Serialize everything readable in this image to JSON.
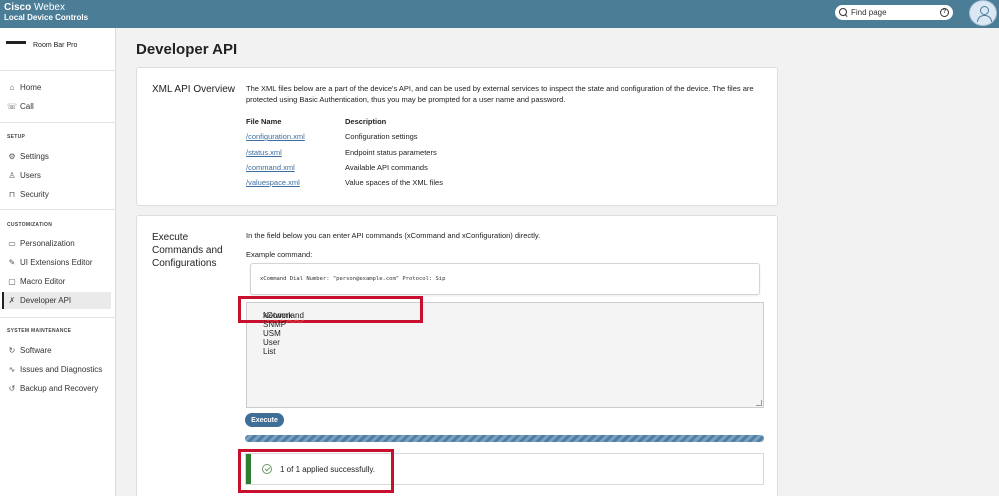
{
  "header": {
    "brand_bold": "Cisco",
    "brand_light": "Webex",
    "subtitle": "Local Device Controls",
    "search_placeholder": "Find page",
    "help_icon": "?"
  },
  "sidebar": {
    "device_name": "Room Bar Pro",
    "items_top": [
      {
        "label": "Home",
        "icon": "home-icon",
        "glyph": "⌂"
      },
      {
        "label": "Call",
        "icon": "phone-icon",
        "glyph": "☏"
      }
    ],
    "setup_heading": "SETUP",
    "setup_items": [
      {
        "label": "Settings",
        "icon": "gear-icon",
        "glyph": "⚙"
      },
      {
        "label": "Users",
        "icon": "user-icon",
        "glyph": "♙"
      },
      {
        "label": "Security",
        "icon": "lock-icon",
        "glyph": "⊓"
      }
    ],
    "custom_heading": "CUSTOMIZATION",
    "custom_items": [
      {
        "label": "Personalization",
        "icon": "image-icon",
        "glyph": "▭"
      },
      {
        "label": "UI Extensions Editor",
        "icon": "pencil-icon",
        "glyph": "✎"
      },
      {
        "label": "Macro Editor",
        "icon": "code-icon",
        "glyph": "▢"
      },
      {
        "label": "Developer API",
        "icon": "tools-icon",
        "glyph": "✗",
        "active": true
      }
    ],
    "maint_heading": "SYSTEM MAINTENANCE",
    "maint_items": [
      {
        "label": "Software",
        "icon": "refresh-icon",
        "glyph": "↻"
      },
      {
        "label": "Issues and Diagnostics",
        "icon": "pulse-icon",
        "glyph": "∿"
      },
      {
        "label": "Backup and Recovery",
        "icon": "restore-icon",
        "glyph": "↺"
      }
    ]
  },
  "main": {
    "title": "Developer API",
    "xml_card": {
      "title": "XML API Overview",
      "description": "The XML files below are a part of the device's API, and can be used by external services to inspect the state and configuration of the device. The files are protected using Basic Authentication, thus you may be prompted for a user name and password.",
      "col_file": "File Name",
      "col_desc": "Description",
      "rows": [
        {
          "file": "/configuration.xml",
          "desc": "Configuration settings"
        },
        {
          "file": "/status.xml",
          "desc": "Endpoint status parameters"
        },
        {
          "file": "/command.xml",
          "desc": "Available API commands"
        },
        {
          "file": "/valuespace.xml",
          "desc": "Value spaces of the XML files"
        }
      ]
    },
    "exec_card": {
      "title_lines": [
        "Execute",
        "Commands and",
        "Configurations"
      ],
      "intro": "In the field below you can enter API commands (xCommand and xConfiguration) directly.",
      "example_label": "Example command:",
      "example_command": "xCommand Dial Number: \"person@example.com\" Protocol: Sip",
      "command_first": "xCommand",
      "command_rest": " Network SNMP USM User List",
      "execute_label": "Execute",
      "result_text": "1 of 1 applied successfully."
    }
  },
  "colors": {
    "header_bg": "#4b7d97",
    "link": "#3d6e9e",
    "highlight": "#c8102e",
    "success": "#2e7d32",
    "button": "#3f6f96"
  }
}
